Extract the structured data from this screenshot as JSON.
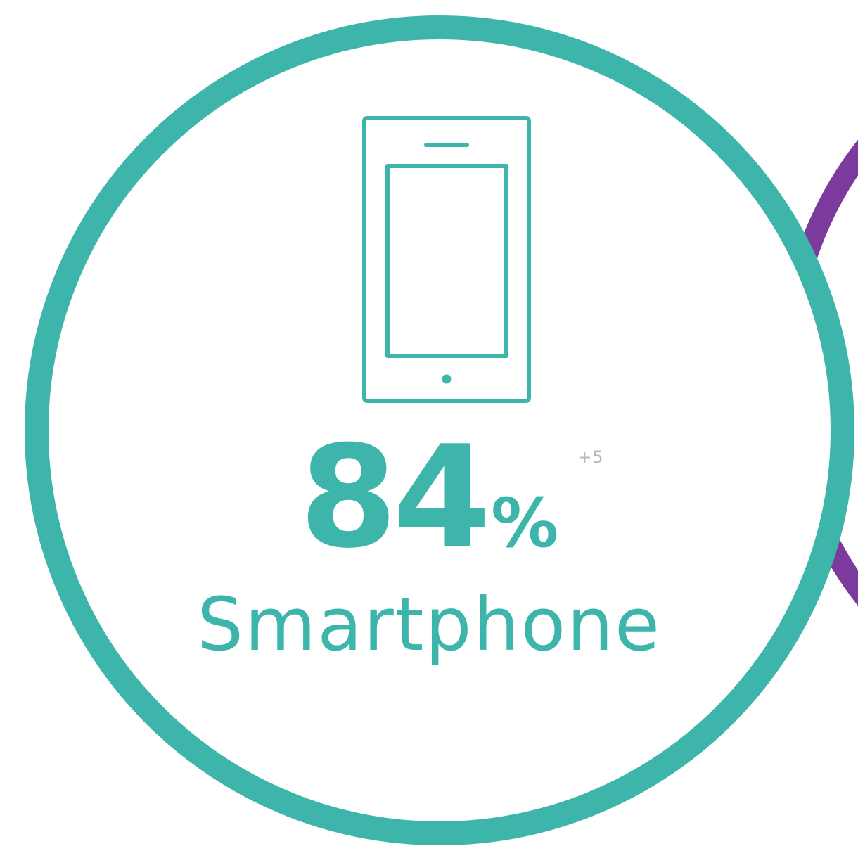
{
  "stat": {
    "value": "84",
    "unit": "%",
    "delta": "+5",
    "label": "Smartphone",
    "icon": "smartphone-icon"
  },
  "colors": {
    "primary": "#3db5aa",
    "secondary": "#7b3a9c",
    "background": "#ffffff",
    "muted": "#b8b8b8"
  }
}
